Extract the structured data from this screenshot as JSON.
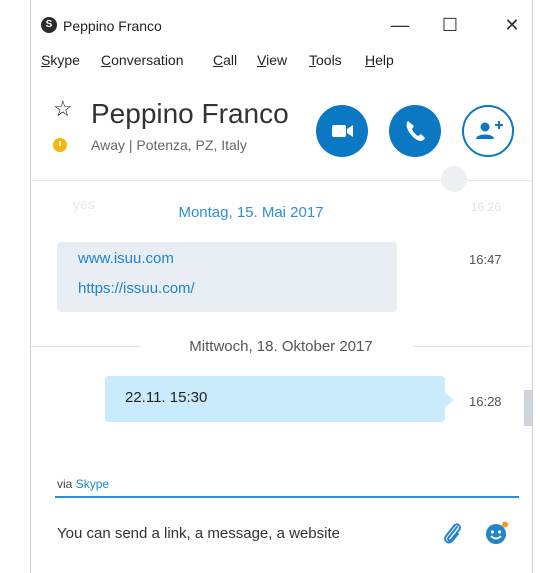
{
  "window": {
    "title": "Peppino Franco",
    "app_icon": "skype-icon"
  },
  "menu": [
    "Skype",
    "Conversation",
    "Call",
    "View",
    "Tools",
    "Help"
  ],
  "contact": {
    "name": "Peppino Franco",
    "status": "Away | Potenza, PZ, Italy"
  },
  "actions": {
    "video_icon": "video-call-icon",
    "call_icon": "phone-call-icon",
    "add_icon": "add-people-icon"
  },
  "conversation": {
    "faded_text": "yes",
    "faded_time": "16:26",
    "date1": "Montag, 15. Mai 2017",
    "message1": {
      "lines": [
        "www.isuu.com",
        "https://issuu.com/"
      ],
      "time": "16:47"
    },
    "date2": "Mittwoch, 18. Oktober 2017",
    "message2": {
      "text": "22.11. 15:30",
      "time": "16:28"
    }
  },
  "compose": {
    "via_prefix": "via",
    "via_service": "Skype",
    "placeholder": "You can send a link, a message, a website",
    "attach_icon": "paperclip-icon",
    "emoji_icon": "emoticon-icon"
  },
  "colors": {
    "accent": "#0a78c2",
    "link": "#1f84cc",
    "bubble_sent": "#c9ebfb",
    "bubble_received": "#e9eef4",
    "away": "#f6b60c"
  }
}
